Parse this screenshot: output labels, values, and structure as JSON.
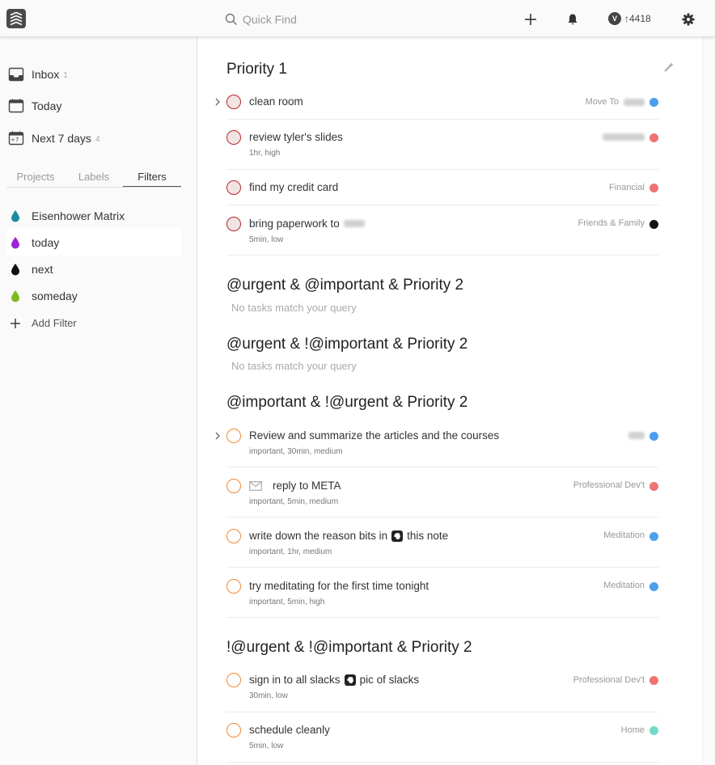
{
  "topbar": {
    "search_placeholder": "Quick Find",
    "karma_points": "↑4418",
    "karma_initial": "V"
  },
  "sidebar": {
    "nav": [
      {
        "label": "Inbox",
        "count": "1",
        "icon": "inbox-icon"
      },
      {
        "label": "Today",
        "count": "",
        "icon": "calendar-today-icon"
      },
      {
        "label": "Next 7 days",
        "count": "4",
        "icon": "calendar-next7-icon"
      }
    ],
    "next7_icon_text": "+7",
    "tabs": [
      "Projects",
      "Labels",
      "Filters"
    ],
    "filters": [
      {
        "label": "Eisenhower Matrix",
        "color": "#1c8ba0"
      },
      {
        "label": "today",
        "color": "#9b25d6"
      },
      {
        "label": "next",
        "color": "#111111"
      },
      {
        "label": "someday",
        "color": "#7fba1d"
      }
    ],
    "add_filter": "Add Filter"
  },
  "sections": [
    {
      "title": "Priority 1",
      "empty": "",
      "tasks": [
        {
          "content": "clean room",
          "labels": "",
          "project": "Move To",
          "dot": "#4a9ff0",
          "has_subtasks": true
        },
        {
          "content": "review tyler's slides",
          "labels": "1hr, high",
          "project": "",
          "dot": "#f07272",
          "has_subtasks": false
        },
        {
          "content": "find my credit card",
          "labels": "",
          "project": "Financial",
          "dot": "#f07272",
          "has_subtasks": false
        },
        {
          "content": "bring paperwork to",
          "labels": "5min, low",
          "project": "Friends & Family",
          "dot": "#111111",
          "has_subtasks": false
        }
      ]
    },
    {
      "title": "@urgent & @important & Priority 2",
      "empty": "No tasks match your query",
      "tasks": []
    },
    {
      "title": "@urgent & !@important & Priority 2",
      "empty": "No tasks match your query",
      "tasks": []
    },
    {
      "title": "@important & !@urgent & Priority 2",
      "empty": "",
      "tasks": [
        {
          "content": "Review and summarize the articles and the courses",
          "labels": "important, 30min, medium",
          "project": "",
          "dot": "#4a9ff0",
          "has_subtasks": true
        },
        {
          "content": "reply to META",
          "labels": "important, 5min, medium",
          "project": "Professional Dev't",
          "dot": "#f07272",
          "has_subtasks": false
        },
        {
          "content_before": "write down the reason bits in",
          "content_after": "this note",
          "labels": "important, 1hr, medium",
          "project": "Meditation",
          "dot": "#4a9ff0",
          "has_subtasks": false
        },
        {
          "content": "try meditating for the first time tonight",
          "labels": "important, 5min, high",
          "project": "Meditation",
          "dot": "#4a9ff0",
          "has_subtasks": false
        }
      ]
    },
    {
      "title": "!@urgent & !@important & Priority 2",
      "empty": "",
      "tasks": [
        {
          "content_before": "sign in to all slacks",
          "content_after": "pic of slacks",
          "labels": "30min, low",
          "project": "Professional Dev't",
          "dot": "#f07272",
          "has_subtasks": false
        },
        {
          "content": "schedule cleanly",
          "labels": "5min, low",
          "project": "Home",
          "dot": "#6fdcc9",
          "has_subtasks": false
        }
      ]
    }
  ]
}
